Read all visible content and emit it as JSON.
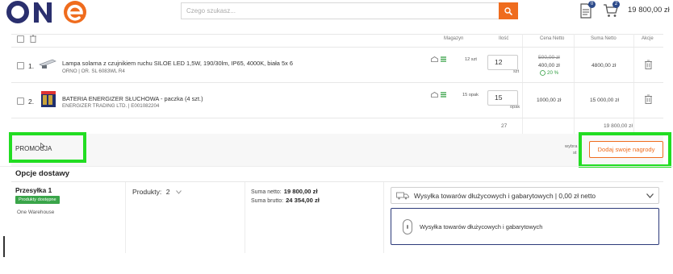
{
  "header": {
    "logo_text": "ONE",
    "search_placeholder": "Czego szukasz...",
    "doc_badge": "0",
    "cart_badge": "2",
    "cart_total": "19 800,00 zł"
  },
  "table": {
    "columns": {
      "magazyn": "Magazyn",
      "ilosc": "Ilość",
      "cena_netto": "Cena Netto",
      "suma_netto": "Suma Netto",
      "akcje": "Akcje"
    },
    "rows": [
      {
        "num": "1.",
        "name": "Lampa solarna z czujnikiem ruchu SILOE LED 1,5W, 190/30lm, IP65, 4000K, biała 5x 6",
        "code": "ORNO | OR. SL 6083WL R4",
        "stock": "12 szt",
        "qty": "12",
        "unit": "szt",
        "price_old": "500,00 zł",
        "price": "400,00 zł",
        "discount": "20 %",
        "sum": "4800,00 zł"
      },
      {
        "num": "2.",
        "name": "BATERIA ENERGIZER SŁUCHOWA - paczka (4 szt.)",
        "code": "ENERGIZER TRADING LTD. | E001082204",
        "stock": "15 opak",
        "qty": "15",
        "unit": "opak",
        "price": "1000,00 zł",
        "sum": "15 000,00 zł"
      }
    ],
    "totals": {
      "qty": "27",
      "sum": "19 800,00 zł"
    }
  },
  "promo": {
    "label": "PROMOCJA",
    "choose_line1": "wybra",
    "choose_line2": "st",
    "rewards_button": "Dodaj swoje nagrody"
  },
  "delivery": {
    "title": "Opcje dostawy",
    "shipment_title": "Przesyłka 1",
    "badge": "Produkty dostępne",
    "warehouse": "One Warehouse",
    "products_label": "Produkty:",
    "products_count": "2",
    "sum_net_label": "Suma netto:",
    "sum_net_value": "19 800,00 zł",
    "sum_gross_label": "Suma brutto:",
    "sum_gross_value": "24 354,00 zł",
    "shipping_selected": "Wysyłka towarów dłużycowych i gabarytowych | 0,00 zł netto",
    "shipping_option": "Wysyłka towarów dłużycowych i gabarytowych"
  },
  "colors": {
    "accent": "#ef6c1e",
    "navy": "#2c3a7a",
    "green": "#3aa54a",
    "highlight": "#22dd22"
  }
}
